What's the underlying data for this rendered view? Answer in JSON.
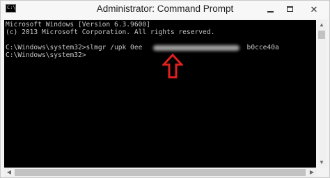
{
  "window": {
    "title": "Administrator: Command Prompt",
    "icon": "cmd-icon",
    "icon_glyph": "C:\\",
    "controls": {
      "minimize": "minimize-icon",
      "maximize": "maximize-icon",
      "close": "close-icon",
      "close_glyph": "✕"
    }
  },
  "console": {
    "lines": [
      "Microsoft Windows [Version 6.3.9600]",
      "(c) 2013 Microsoft Corporation. All rights reserved.",
      "",
      "C:\\Windows\\system32>slmgr /upk 0ee                          b0cce40a",
      "",
      "C:\\Windows\\system32>"
    ],
    "annotation": "red-up-arrow-icon"
  },
  "colors": {
    "console_bg": "#000000",
    "console_text": "#c8c8c8",
    "arrow": "#e02020"
  },
  "scrollbars": {
    "vertical": {
      "up": "▲",
      "down": "▼"
    },
    "horizontal": {
      "left": "◀",
      "right": "▶"
    }
  }
}
